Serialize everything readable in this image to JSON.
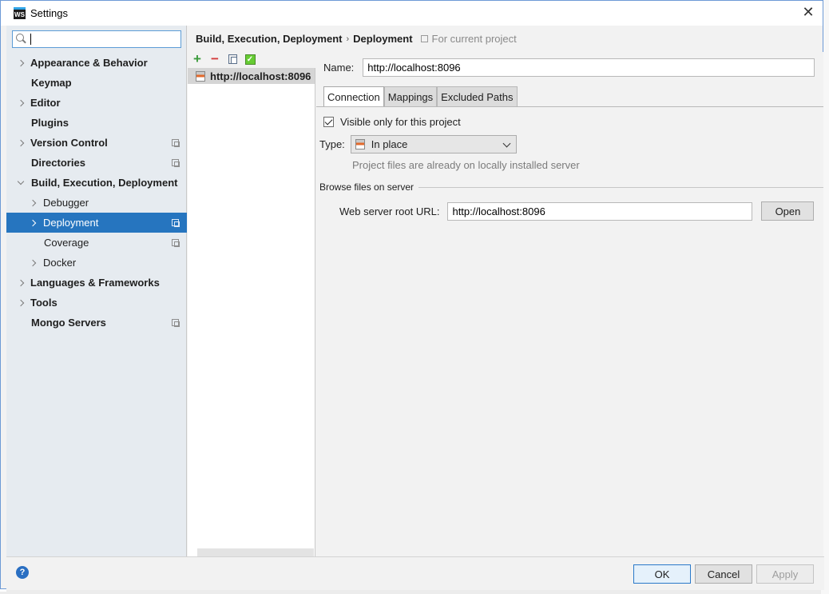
{
  "window": {
    "title": "Settings",
    "app_icon": "WS"
  },
  "search": {
    "value": "",
    "placeholder": ""
  },
  "sidebar": {
    "items": [
      {
        "label": "Appearance & Behavior"
      },
      {
        "label": "Keymap"
      },
      {
        "label": "Editor"
      },
      {
        "label": "Plugins"
      },
      {
        "label": "Version Control"
      },
      {
        "label": "Directories"
      },
      {
        "label": "Build, Execution, Deployment"
      },
      {
        "label": "Debugger"
      },
      {
        "label": "Deployment"
      },
      {
        "label": "Coverage"
      },
      {
        "label": "Docker"
      },
      {
        "label": "Languages & Frameworks"
      },
      {
        "label": "Tools"
      },
      {
        "label": "Mongo Servers"
      }
    ],
    "selected": "Deployment"
  },
  "breadcrumb": {
    "parent": "Build, Execution, Deployment",
    "separator": "›",
    "current": "Deployment",
    "scope": "For current project"
  },
  "servers": {
    "items": [
      {
        "label": "http://localhost:8096"
      }
    ]
  },
  "form": {
    "name_label": "Name:",
    "name_value": "http://localhost:8096",
    "tabs": [
      {
        "label": "Connection"
      },
      {
        "label": "Mappings"
      },
      {
        "label": "Excluded Paths"
      }
    ],
    "visible_label": "Visible only for this project",
    "visible_checked": true,
    "type_label": "Type:",
    "type_value": "In place",
    "type_hint": "Project files are already on locally installed server",
    "section_title": "Browse files on server",
    "root_url_label": "Web server root URL:",
    "root_url_value": "http://localhost:8096",
    "open_label": "Open"
  },
  "footer": {
    "ok": "OK",
    "cancel": "Cancel",
    "apply": "Apply",
    "help": "?"
  },
  "colors": {
    "selection": "#2675bf",
    "accent_border": "#2a79c9",
    "plus": "#3c9b3c",
    "minus": "#d33a3a"
  }
}
